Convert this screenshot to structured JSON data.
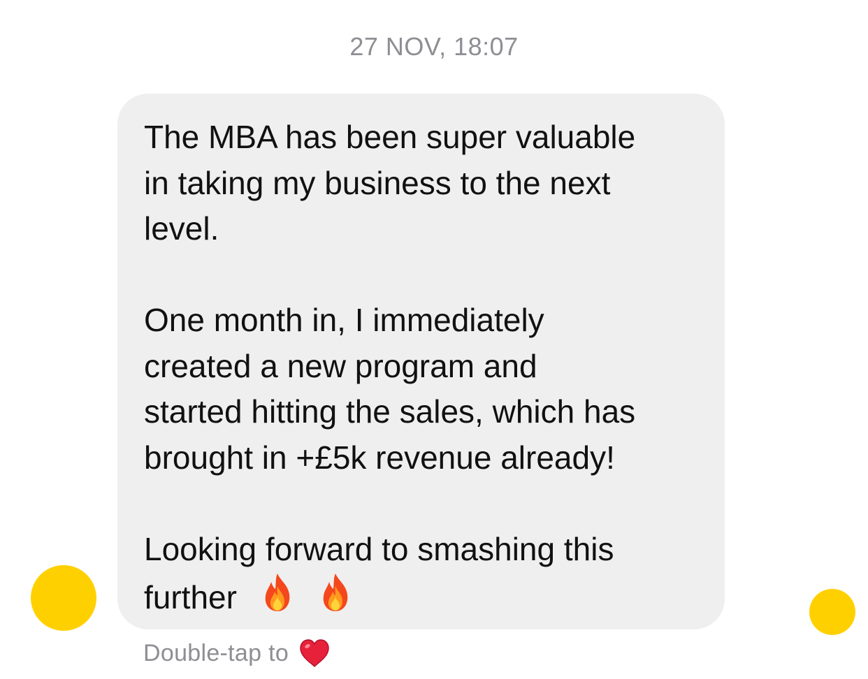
{
  "thread": {
    "timestamp": "27 NOV, 18:07"
  },
  "message": {
    "lines": [
      "The MBA has been super valuable",
      "in taking my business to the next",
      "level.",
      "",
      "One month in, I immediately",
      "created a new program and",
      "started hitting the sales, which has",
      "brought in +£5k revenue already!",
      "",
      "Looking forward to smashing this",
      "further"
    ],
    "reaction_icons": [
      "fire-icon",
      "fire-icon"
    ],
    "bubble_color": "#efefef",
    "text_color": "#111111"
  },
  "hint": {
    "text": "Double-tap to",
    "icon": "heart-icon"
  },
  "colors": {
    "avatar": "#ffd000",
    "meta_text": "#8e8e93"
  }
}
